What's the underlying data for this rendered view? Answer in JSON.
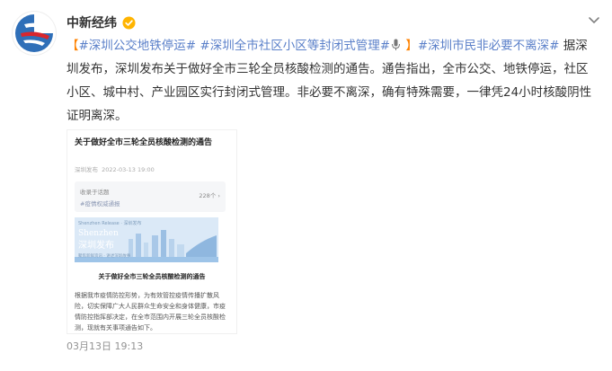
{
  "author": {
    "name": "中新经纬",
    "verified": true
  },
  "post": {
    "bracket_open": "【",
    "tag1": "#深圳公交地铁停运#",
    "tag2": "#深圳全市社区小区等封闭式管理#",
    "bracket_close": "】",
    "tag3": "#深圳市民非必要不离深#",
    "body": "据深圳发布，深圳发布关于做好全市三轮全员核酸检测的通告。通告指出，全市公交、地铁停运，社区小区、城中村、产业园区实行封闭式管理。非必要不离深，确有特殊需要，一律凭24小时核酸阴性证明离深。"
  },
  "article": {
    "title": "关于做好全市三轮全员核酸检测的通告",
    "source": "深圳发布",
    "date": "2022-03-13 19:00",
    "topic_label": "收录于话题",
    "topic_tag": "#疫情权威通报",
    "topic_count": "228个",
    "banner_top": "Shenzhen Release · 深圳发布",
    "banner_en": "Shenzhen",
    "banner_cn": "深圳发布",
    "banner_bottom": "聚焦新鲜资讯 · 讲述深圳故事",
    "heading": "关于做好全市三轮全员核酸检测的通告",
    "body": "根据我市疫情防控形势，为有效管控疫情传播扩散风险，切实保障广大人民群众生命安全和身体健康，市疫情防控指挥部决定，在全市范围内开展三轮全员核酸检测，现就有关事项通告如下。"
  },
  "timestamp": "03月13日 19:13",
  "colors": {
    "tag": "#5b80c9",
    "bracket": "#ff8200",
    "verified": "#ffb400"
  }
}
